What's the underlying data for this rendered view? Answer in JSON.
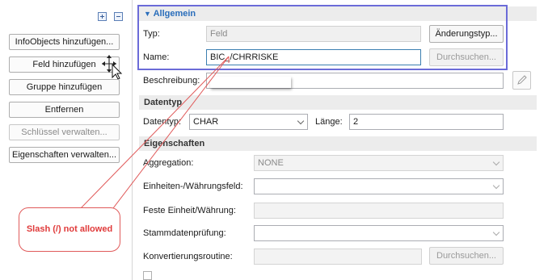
{
  "left_panel": {
    "buttons": [
      "InfoObjects hinzufügen...",
      "Feld hinzufügen",
      "Gruppe hinzufügen",
      "Entfernen",
      "Schlüssel verwalten...",
      "Eigenschaften verwalten..."
    ]
  },
  "allgemein": {
    "header": "Allgemein",
    "typ_label": "Typ:",
    "typ_value": "Feld",
    "aenderungstyp_button": "Änderungstyp...",
    "name_label": "Name:",
    "name_value": "BIC_/CHRRISKE",
    "durchsuchen_button": "Durchsuchen..."
  },
  "beschreibung": {
    "label": "Beschreibung:",
    "value": ""
  },
  "datentyp": {
    "header": "Datentyp",
    "label": "Datentyp:",
    "value": "CHAR",
    "laenge_label": "Länge:",
    "laenge_value": "2"
  },
  "eigenschaften": {
    "header": "Eigenschaften",
    "aggregation_label": "Aggregation:",
    "aggregation_value": "NONE",
    "einheiten_label": "Einheiten-/Währungsfeld:",
    "einheiten_value": "",
    "feste_label": "Feste Einheit/Währung:",
    "feste_value": "",
    "stammdaten_label": "Stammdatenprüfung:",
    "stammdaten_value": "",
    "konvertierung_label": "Konvertierungsroutine:",
    "konvertierung_value": "",
    "konvertierung_button": "Durchsuchen..."
  },
  "annotation": {
    "text": "Slash (/) not allowed",
    "color": "#e03a3a"
  },
  "colors": {
    "accent": "#2a6ebb",
    "highlight_border": "#6b6bd8",
    "annotation": "#e05a5a"
  },
  "icons": [
    "expand-all-icon",
    "collapse-all-icon",
    "move-cursor-icon",
    "chevron-down-icon",
    "edit-pencil-icon"
  ]
}
